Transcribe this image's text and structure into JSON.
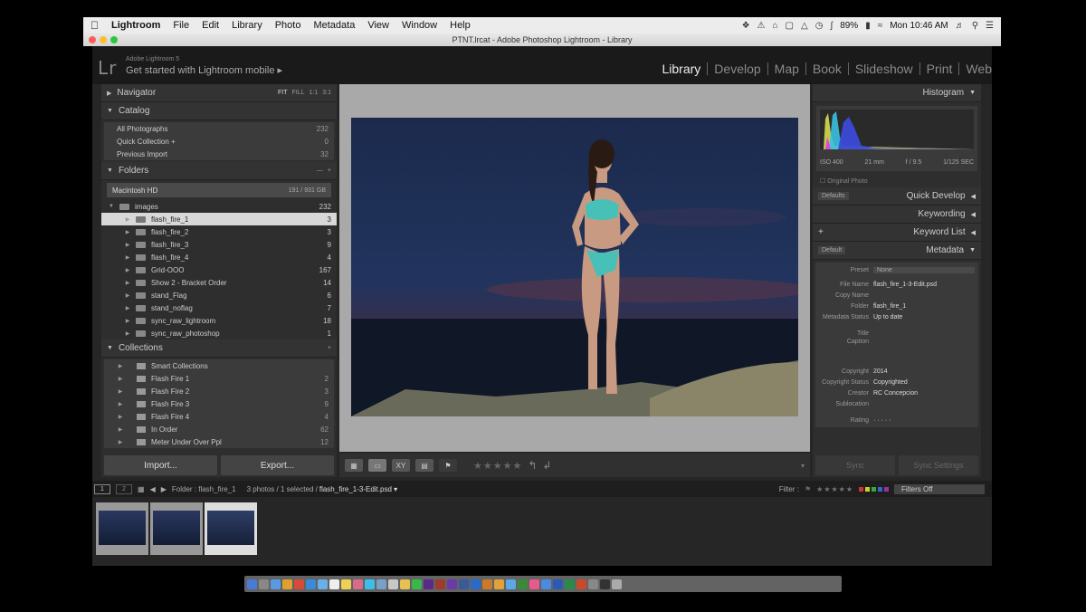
{
  "menubar": {
    "app": "Lightroom",
    "items": [
      "File",
      "Edit",
      "Library",
      "Photo",
      "Metadata",
      "View",
      "Window",
      "Help"
    ],
    "battery": "89%",
    "clock": "Mon 10:46 AM"
  },
  "window": {
    "title": "PTNT.lrcat - Adobe Photoshop Lightroom - Library"
  },
  "identity": {
    "logo": "Lr",
    "small": "Adobe Lightroom 5",
    "big": "Get started with Lightroom mobile ▸"
  },
  "modules": [
    "Library",
    "Develop",
    "Map",
    "Book",
    "Slideshow",
    "Print",
    "Web"
  ],
  "navigator": {
    "title": "Navigator",
    "zoom": [
      "FIT",
      "FILL",
      "1:1",
      "3:1"
    ]
  },
  "catalog": {
    "title": "Catalog",
    "items": [
      {
        "label": "All Photographs",
        "count": "232"
      },
      {
        "label": "Quick Collection +",
        "count": "0"
      },
      {
        "label": "Previous Import",
        "count": "32"
      }
    ]
  },
  "folders": {
    "title": "Folders",
    "volume": {
      "name": "Macintosh HD",
      "size": "191 / 931 GB"
    },
    "root": {
      "name": "images",
      "count": "232"
    },
    "items": [
      {
        "name": "flash_fire_1",
        "count": "3"
      },
      {
        "name": "flash_fire_2",
        "count": "3"
      },
      {
        "name": "flash_fire_3",
        "count": "9"
      },
      {
        "name": "flash_fire_4",
        "count": "4"
      },
      {
        "name": "Grid-OOO",
        "count": "167"
      },
      {
        "name": "Show 2 - Bracket Order",
        "count": "14"
      },
      {
        "name": "stand_Flag",
        "count": "6"
      },
      {
        "name": "stand_noflag",
        "count": "7"
      },
      {
        "name": "sync_raw_lightroom",
        "count": "18"
      },
      {
        "name": "sync_raw_photoshop",
        "count": "1"
      }
    ]
  },
  "collections": {
    "title": "Collections",
    "items": [
      {
        "name": "Smart Collections",
        "count": ""
      },
      {
        "name": "Flash Fire 1",
        "count": "2"
      },
      {
        "name": "Flash Fire 2",
        "count": "3"
      },
      {
        "name": "Flash Fire 3",
        "count": "9"
      },
      {
        "name": "Flash Fire 4",
        "count": "4"
      },
      {
        "name": "In Order",
        "count": "62"
      },
      {
        "name": "Meter Under Over Ppl",
        "count": "12"
      }
    ]
  },
  "buttons": {
    "import": "Import...",
    "export": "Export..."
  },
  "toolbar": {
    "stars": "★★★★★"
  },
  "histogram": {
    "title": "Histogram",
    "iso": "ISO 400",
    "focal": "21 mm",
    "aperture": "f / 9.5",
    "shutter": "1/125 SEC",
    "original": "Original Photo"
  },
  "right_panels": {
    "quick_develop": "Quick Develop",
    "quick_preset": "Defaults",
    "keywording": "Keywording",
    "keyword_list": "Keyword List",
    "metadata": "Metadata",
    "metadata_preset": "Default"
  },
  "metadata": {
    "preset_label": "Preset",
    "preset_value": "None",
    "rows": [
      {
        "k": "File Name",
        "v": "flash_fire_1-3-Edit.psd"
      },
      {
        "k": "Copy Name",
        "v": ""
      },
      {
        "k": "Folder",
        "v": "flash_fire_1"
      },
      {
        "k": "Metadata Status",
        "v": "Up to date"
      },
      {
        "k": "Title",
        "v": ""
      },
      {
        "k": "Caption",
        "v": ""
      },
      {
        "k": "Copyright",
        "v": "2014"
      },
      {
        "k": "Copyright Status",
        "v": "Copyrighted"
      },
      {
        "k": "Creator",
        "v": "RC Concepcion"
      },
      {
        "k": "Sublocation",
        "v": ""
      },
      {
        "k": "Rating",
        "v": "· · · · ·"
      }
    ]
  },
  "sync": {
    "sync": "Sync",
    "settings": "Sync Settings"
  },
  "filmbar": {
    "page1": "1",
    "page2": "2",
    "folder": "Folder : flash_fire_1",
    "status": "3 photos / 1 selected /",
    "selected_file": "flash_fire_1-3-Edit.psd ▾",
    "filter_label": "Filter :",
    "filter_value": "Filters Off"
  },
  "colors": {
    "accent": "#dddddd",
    "panel": "#2e2e2e",
    "background": "#262626"
  }
}
